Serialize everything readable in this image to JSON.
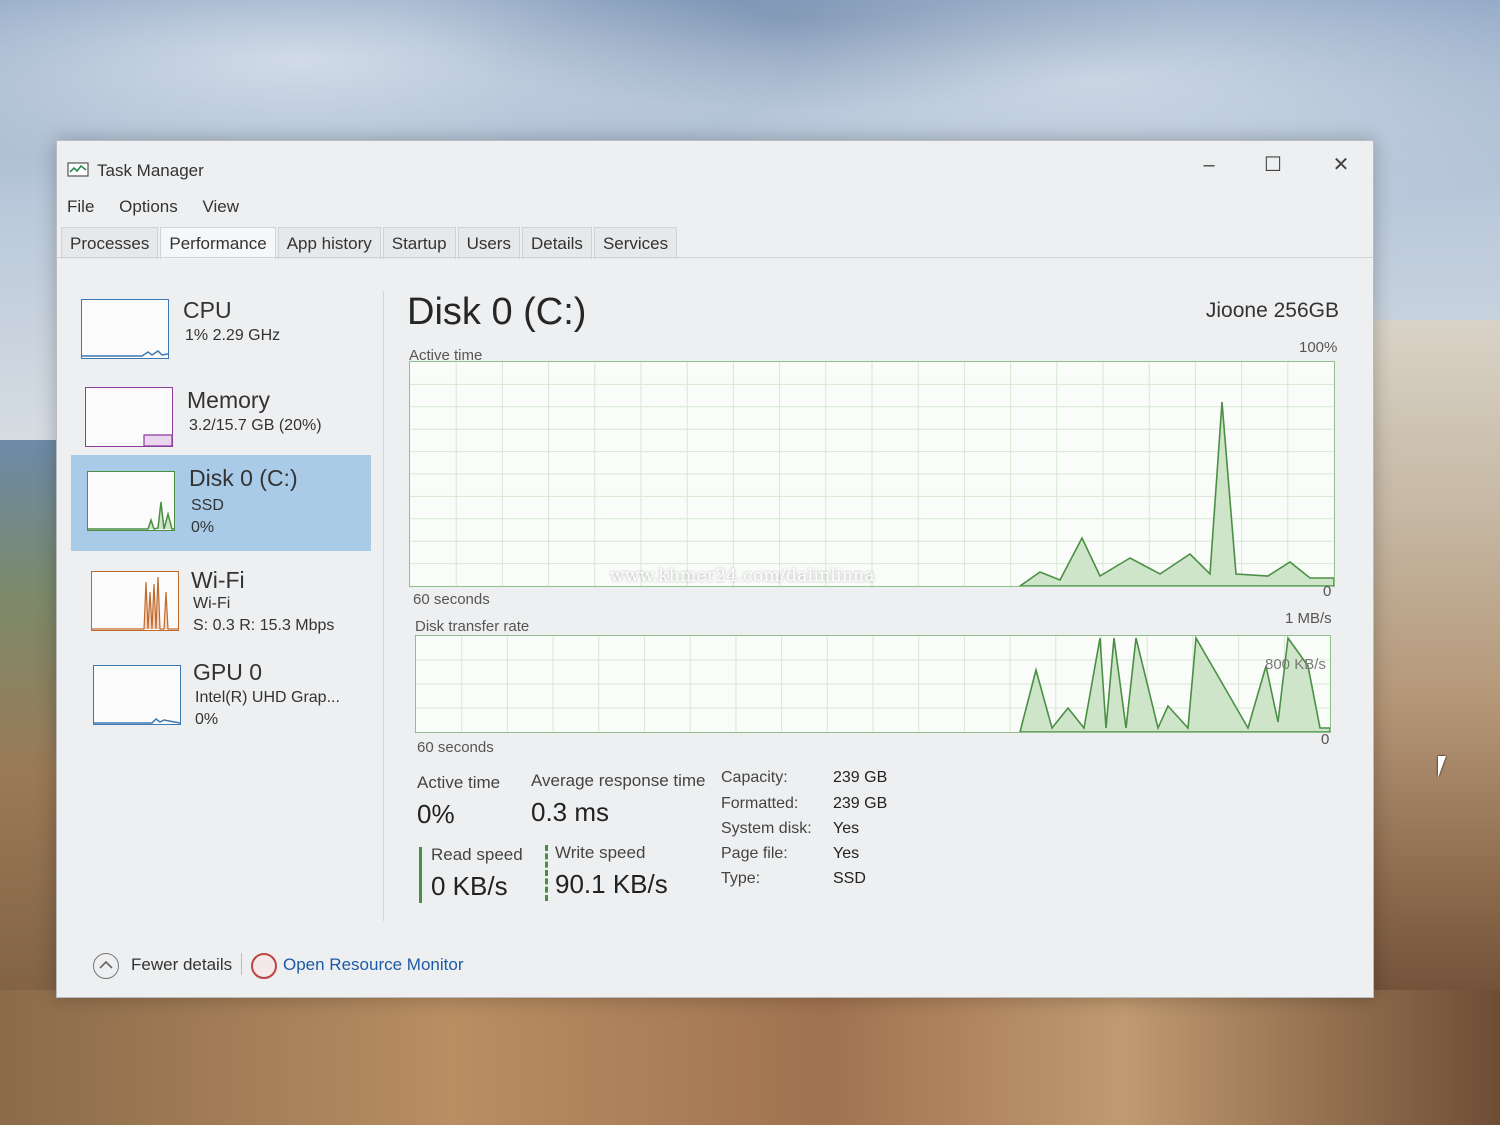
{
  "window": {
    "title": "Task Manager"
  },
  "menu": [
    "File",
    "Options",
    "View"
  ],
  "tabs": [
    "Processes",
    "Performance",
    "App history",
    "Startup",
    "Users",
    "Details",
    "Services"
  ],
  "active_tab": "Performance",
  "sidebar": {
    "items": [
      {
        "name": "CPU",
        "line1": "1% 2.29 GHz",
        "line2": "",
        "thumb_color": "#3c78b4"
      },
      {
        "name": "Memory",
        "line1": "3.2/15.7 GB (20%)",
        "line2": "",
        "thumb_color": "#8b3e9e"
      },
      {
        "name": "Disk 0 (C:)",
        "line1": "SSD",
        "line2": "0%",
        "thumb_color": "#4b8f45"
      },
      {
        "name": "Wi-Fi",
        "line1": "Wi-Fi",
        "line2": "S: 0.3 R: 15.3 Mbps",
        "thumb_color": "#c06a2c"
      },
      {
        "name": "GPU 0",
        "line1": "Intel(R) UHD Grap...",
        "line2": "0%",
        "thumb_color": "#3c78b4"
      }
    ]
  },
  "main": {
    "title": "Disk 0 (C:)",
    "model": "Jioone 256GB",
    "active_graph": {
      "label": "Active time",
      "max": "100%",
      "min": "0",
      "span": "60 seconds"
    },
    "transfer_graph": {
      "label": "Disk transfer rate",
      "max": "1 MB/s",
      "mid": "800 KB/s",
      "min": "0",
      "span": "60 seconds"
    },
    "stats": {
      "active_time_label": "Active time",
      "active_time": "0%",
      "avg_resp_label": "Average response time",
      "avg_resp": "0.3 ms",
      "read_label": "Read speed",
      "read": "0 KB/s",
      "write_label": "Write speed",
      "write": "90.1 KB/s"
    },
    "properties": [
      {
        "label": "Capacity:",
        "value": "239 GB"
      },
      {
        "label": "Formatted:",
        "value": "239 GB"
      },
      {
        "label": "System disk:",
        "value": "Yes"
      },
      {
        "label": "Page file:",
        "value": "Yes"
      },
      {
        "label": "Type:",
        "value": "SSD"
      }
    ]
  },
  "footer": {
    "fewer": "Fewer details",
    "resource_monitor": "Open Resource Monitor"
  },
  "watermark": "www.khmer24.com/dalinlinna",
  "colors": {
    "disk_green": "#4b8f45",
    "graph_fill": "#cfe5c9",
    "selected_bg": "#a9cbe8",
    "link_blue": "#1c5aa6"
  }
}
